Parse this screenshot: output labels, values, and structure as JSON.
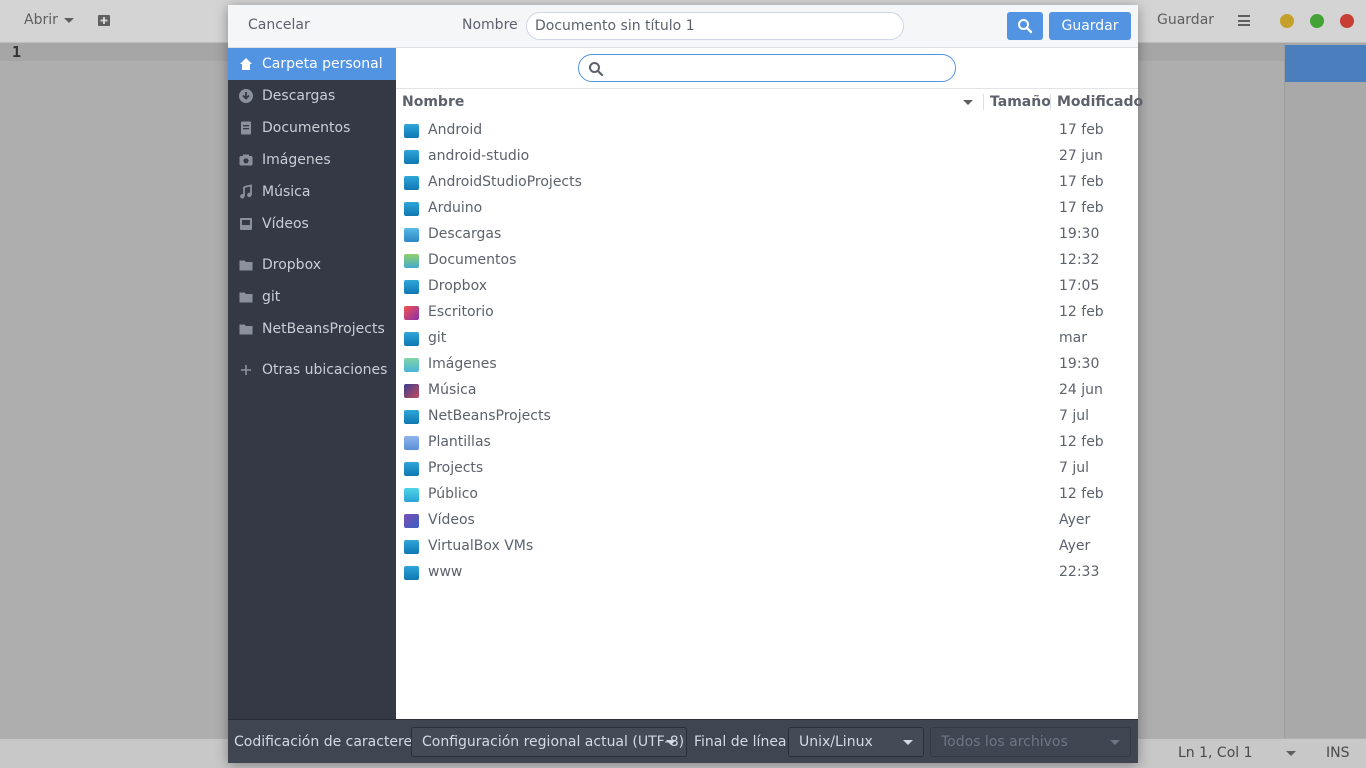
{
  "background_window": {
    "open_label": "Abrir",
    "save_label": "Guardar",
    "line_number": "1",
    "status_position": "Ln 1, Col 1",
    "status_mode": "INS",
    "window_controls": [
      "#c5a12b",
      "#43a435",
      "#c83d34"
    ]
  },
  "dialog": {
    "cancel_label": "Cancelar",
    "name_label": "Nombre",
    "name_value": "Documento sin título 1",
    "save_label": "Guardar",
    "accent_color": "#5294e2"
  },
  "sidebar": {
    "items": [
      {
        "label": "Carpeta personal",
        "icon": "home-icon"
      },
      {
        "label": "Descargas",
        "icon": "download-icon"
      },
      {
        "label": "Documentos",
        "icon": "document-icon"
      },
      {
        "label": "Imágenes",
        "icon": "camera-icon"
      },
      {
        "label": "Música",
        "icon": "music-icon"
      },
      {
        "label": "Vídeos",
        "icon": "video-icon"
      },
      {
        "label": "Dropbox",
        "icon": "folder-icon"
      },
      {
        "label": "git",
        "icon": "folder-icon"
      },
      {
        "label": "NetBeansProjects",
        "icon": "folder-icon"
      },
      {
        "label": "Otras ubicaciones",
        "icon": "plus-icon"
      }
    ]
  },
  "file_list": {
    "columns": {
      "name": "Nombre",
      "size": "Tamaño",
      "modified": "Modificado"
    },
    "rows": [
      {
        "name": "Android",
        "modified": "17 feb",
        "icon": "folder-icon"
      },
      {
        "name": "android-studio",
        "modified": "27 jun",
        "icon": "folder-icon"
      },
      {
        "name": "AndroidStudioProjects",
        "modified": "17 feb",
        "icon": "folder-icon"
      },
      {
        "name": "Arduino",
        "modified": "17 feb",
        "icon": "folder-icon"
      },
      {
        "name": "Descargas",
        "modified": "19:30",
        "icon": "downloads-folder-icon"
      },
      {
        "name": "Documentos",
        "modified": "12:32",
        "icon": "documents-folder-icon"
      },
      {
        "name": "Dropbox",
        "modified": "17:05",
        "icon": "folder-icon"
      },
      {
        "name": "Escritorio",
        "modified": "12 feb",
        "icon": "desktop-folder-icon"
      },
      {
        "name": "git",
        "modified": "mar",
        "icon": "folder-icon"
      },
      {
        "name": "Imágenes",
        "modified": "19:30",
        "icon": "pictures-folder-icon"
      },
      {
        "name": "Música",
        "modified": "24 jun",
        "icon": "music-folder-icon"
      },
      {
        "name": "NetBeansProjects",
        "modified": "7 jul",
        "icon": "folder-icon"
      },
      {
        "name": "Plantillas",
        "modified": "12 feb",
        "icon": "templates-folder-icon"
      },
      {
        "name": "Projects",
        "modified": "7 jul",
        "icon": "folder-icon"
      },
      {
        "name": "Público",
        "modified": "12 feb",
        "icon": "public-folder-icon"
      },
      {
        "name": "Vídeos",
        "modified": "Ayer",
        "icon": "videos-folder-icon"
      },
      {
        "name": "VirtualBox VMs",
        "modified": "Ayer",
        "icon": "folder-icon"
      },
      {
        "name": "www",
        "modified": "22:33",
        "icon": "folder-icon"
      }
    ]
  },
  "footer": {
    "encoding_label": "Codificación de caracteres:",
    "encoding_value": "Configuración regional actual (UTF-8)",
    "line_ending_label": "Final de línea:",
    "line_ending_value": "Unix/Linux",
    "filter_value": "Todos los archivos"
  }
}
